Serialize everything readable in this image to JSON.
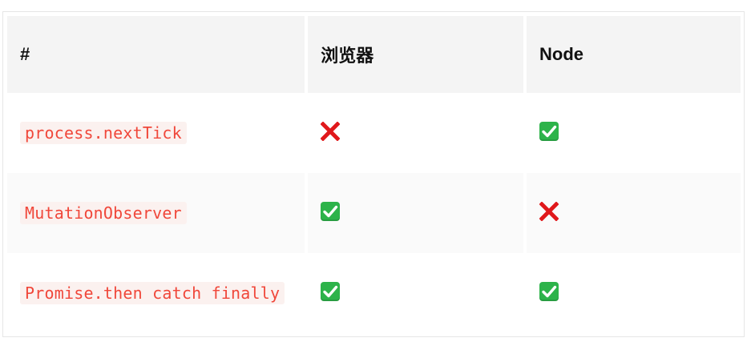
{
  "table": {
    "headers": [
      "#",
      "浏览器",
      "Node"
    ],
    "rows": [
      {
        "api": "process.nextTick",
        "browser": "cross-mark-icon",
        "node": "check-mark-icon"
      },
      {
        "api": "MutationObserver",
        "browser": "check-mark-icon",
        "node": "cross-mark-icon"
      },
      {
        "api": "Promise.then catch finally",
        "browser": "check-mark-icon",
        "node": "check-mark-icon"
      }
    ]
  },
  "colors": {
    "code_text": "#f0473a",
    "code_bg": "#fbf1ef",
    "header_bg": "#f4f4f4",
    "check_green": "#2db34a",
    "cross_red": "#e0181b"
  }
}
